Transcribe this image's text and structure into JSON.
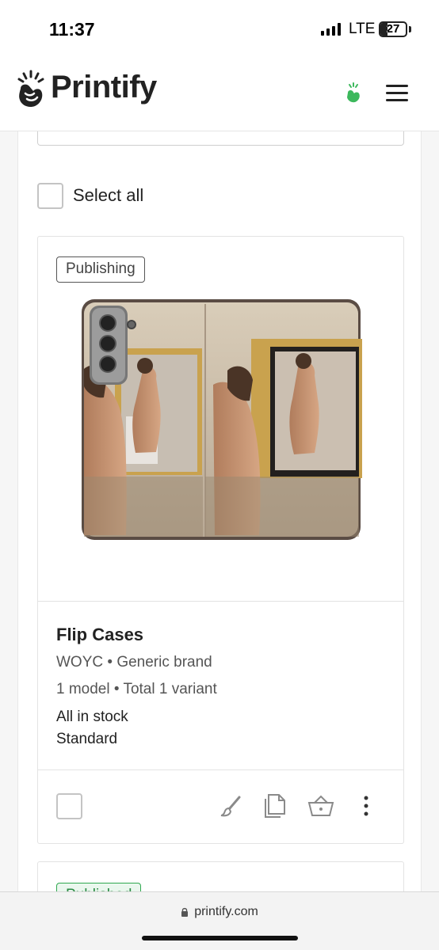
{
  "status_bar": {
    "time": "11:37",
    "network": "LTE",
    "battery_level": "27",
    "signal_icon": "cellular-signal-icon",
    "battery_icon": "battery-icon"
  },
  "header": {
    "logo_text": "Printify",
    "logo_icon": "printify-logo-icon",
    "promo_icon": "hand-sparkle-icon",
    "menu_icon": "hamburger-menu-icon"
  },
  "list": {
    "select_all_label": "Select all"
  },
  "products": [
    {
      "status": "Publishing",
      "title": "Flip Cases",
      "brand_line": "WOYC • Generic brand",
      "variants_line": "1 model • Total 1 variant",
      "stock": "All in stock",
      "shipping": "Standard",
      "actions": [
        "edit-brush-icon",
        "duplicate-icon",
        "order-basket-icon",
        "more-options-icon"
      ]
    },
    {
      "status": "Published"
    }
  ],
  "browser": {
    "url": "printify.com",
    "lock_icon": "lock-icon"
  },
  "colors": {
    "brand_green": "#2fa84f",
    "text_dark": "#222222",
    "text_muted": "#555555"
  }
}
